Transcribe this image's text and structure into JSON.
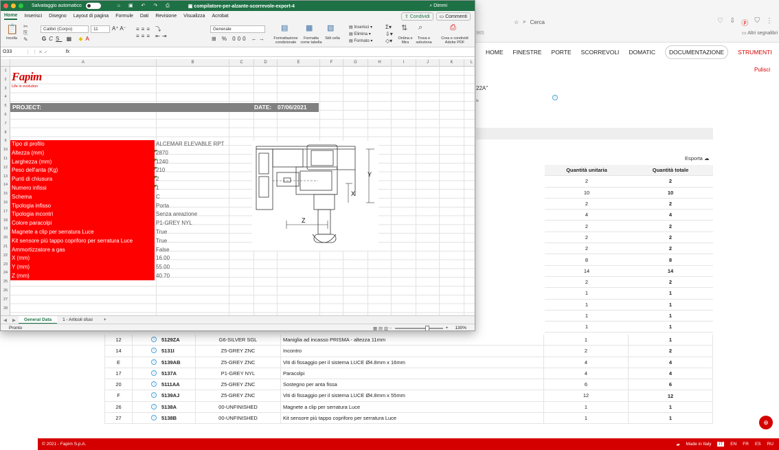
{
  "browser": {
    "search_placeholder": "Cerca",
    "bookmarks_label": "Altri segnalibri",
    "side_number": "965"
  },
  "site": {
    "nav": [
      "HOME",
      "FINESTRE",
      "PORTE",
      "SCORREVOLI",
      "DOMATIC",
      "DOCUMENTAZIONE",
      "STRUMENTI"
    ],
    "pulisci": "Pulisci",
    "partial_code": "22A\"",
    "partial_small": "is",
    "esporta": "Esporta",
    "col_qu": "Quantità unitaria",
    "col_qt": "Quantità totale",
    "right_rows": [
      [
        "2",
        "2"
      ],
      [
        "10",
        "10"
      ],
      [
        "2",
        "2"
      ],
      [
        "4",
        "4"
      ],
      [
        "2",
        "2"
      ],
      [
        "2",
        "2"
      ],
      [
        "2",
        "2"
      ],
      [
        "8",
        "8"
      ],
      [
        "14",
        "14"
      ],
      [
        "2",
        "2"
      ],
      [
        "1",
        "1"
      ],
      [
        "1",
        "1"
      ],
      [
        "1",
        "1"
      ],
      [
        "1",
        "1"
      ]
    ],
    "lower_rows": [
      {
        "pos": "12",
        "code": "5129ZA",
        "finish": "G6-SILVER SGL",
        "desc": "Maniglia ad incasso PRISMA - altezza 11mm",
        "qu": "1",
        "qt": "1"
      },
      {
        "pos": "14",
        "code": "5131I",
        "finish": "Z5-GREY ZNC",
        "desc": "Incontro",
        "qu": "2",
        "qt": "2"
      },
      {
        "pos": "E",
        "code": "5139AB",
        "finish": "Z5-GREY ZNC",
        "desc": "Viti di fissaggio per il sistema LUCE Ø4.8mm x 16mm",
        "qu": "4",
        "qt": "4"
      },
      {
        "pos": "17",
        "code": "5137A",
        "finish": "P1-GREY NYL",
        "desc": "Paracolpi",
        "qu": "4",
        "qt": "4"
      },
      {
        "pos": "20",
        "code": "5111AA",
        "finish": "Z5-GREY ZNC",
        "desc": "Sostegno per anta fissa",
        "qu": "6",
        "qt": "6"
      },
      {
        "pos": "F",
        "code": "5139AJ",
        "finish": "Z5-GREY ZNC",
        "desc": "Viti di fissaggio per il sistema LUCE Ø4.8mm x 55mm",
        "qu": "12",
        "qt": "12"
      },
      {
        "pos": "26",
        "code": "5138A",
        "finish": "00-UNFINISHED",
        "desc": "Magnete a clip per serratura Luce",
        "qu": "1",
        "qt": "1"
      },
      {
        "pos": "27",
        "code": "5138B",
        "finish": "00-UNFINISHED",
        "desc": "Kit sensore più tappo copriforo per serratura Luce",
        "qu": "1",
        "qt": "1"
      }
    ],
    "footer_copy": "© 2021 - Fapim S.p.A.",
    "footer_made": "Made in Italy",
    "langs": [
      "IT",
      "EN",
      "FR",
      "ES",
      "RU"
    ]
  },
  "excel": {
    "autosave": "Salvataggio automatico",
    "filename": "compilatore-per-alzante-scorrevole-export-4",
    "search": "Dimmi",
    "tabs": [
      "Home",
      "Inserisci",
      "Disegno",
      "Layout di pagina",
      "Formule",
      "Dati",
      "Revisione",
      "Visualizza",
      "Acrobat"
    ],
    "share": "Condividi",
    "comments": "Commenti",
    "ribbon": {
      "paste": "Incolla",
      "font": "Calibri (Corpo)",
      "size": "11",
      "number_format": "Generale",
      "cond_format": "Formattazione condizionale",
      "format_table": "Formatta come tabella",
      "cell_styles": "Stili cella",
      "insert": "Inserisci",
      "delete": "Elimina",
      "format": "Formato",
      "sort": "Ordina e filtra",
      "find": "Trova e seleziona",
      "pdf": "Crea e condividi Adobe PDF"
    },
    "cell_ref": "O33",
    "fx": "fx",
    "columns": [
      "A",
      "B",
      "C",
      "D",
      "E",
      "F",
      "G",
      "H",
      "I",
      "J",
      "K",
      "L"
    ],
    "rows": [
      "1",
      "2",
      "3",
      "4",
      "5",
      "6",
      "7",
      "8",
      "9",
      "10",
      "11",
      "12",
      "13",
      "14",
      "15",
      "16",
      "17",
      "18",
      "19",
      "20",
      "21",
      "22",
      "23",
      "24",
      "25",
      "26",
      "27",
      "28"
    ],
    "logo_brand": "Fapim",
    "logo_tag": "Life in evolution",
    "project_label": "PROJECT:",
    "date_label": "DATE:",
    "date_value": "07/06/2021",
    "params": [
      {
        "label": "Tipo di profilo",
        "value": "ALCEMAR ELEVABLE RPT",
        "flag": false
      },
      {
        "label": "Altezza (mm)",
        "value": "2870",
        "flag": true
      },
      {
        "label": "Larghezza (mm)",
        "value": "1240",
        "flag": true
      },
      {
        "label": "Peso dell'anta (Kg)",
        "value": "210",
        "flag": true
      },
      {
        "label": "Punti di chiusura",
        "value": "2",
        "flag": true
      },
      {
        "label": "Numero infissi",
        "value": "1",
        "flag": true
      },
      {
        "label": "Schema",
        "value": "C",
        "flag": false
      },
      {
        "label": "Tipologia infisso",
        "value": "Porta",
        "flag": false
      },
      {
        "label": "Tipologia incontri",
        "value": "Senza areazione",
        "flag": false
      },
      {
        "label": "Colore paracolpi",
        "value": "P1-GREY NYL",
        "flag": false
      },
      {
        "label": "Magnete a clip per serratura Luce",
        "value": "True",
        "flag": false
      },
      {
        "label": "Kit sensore più tappo copriforo per serratura Luce",
        "value": "True",
        "flag": false
      },
      {
        "label": "Ammortizzatore a gas",
        "value": "False",
        "flag": false
      },
      {
        "label": "X (mm)",
        "value": "16.00",
        "flag": false
      },
      {
        "label": "Y (mm)",
        "value": "55.00",
        "flag": false
      },
      {
        "label": "Z (mm)",
        "value": "40.70",
        "flag": false
      }
    ],
    "drawing_labels": {
      "x": "X",
      "y": "Y",
      "z": "Z"
    },
    "sheet_tabs": [
      "General Data",
      "1 - Articoli sfusi"
    ],
    "status": "Pronto",
    "zoom": "130%"
  },
  "colors": {
    "excel_green": "#1e7145",
    "fapim_red": "#d40000",
    "param_red": "#ff0000"
  }
}
